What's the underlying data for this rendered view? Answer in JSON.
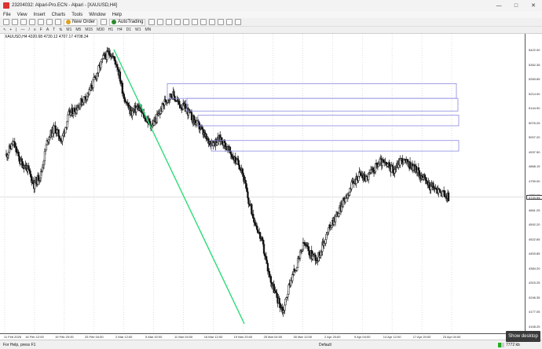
{
  "window": {
    "title": "23204032: Alpari-Pro.ECN - Alpari - [XAUUSD,H4]",
    "minimize": "—",
    "maximize": "□",
    "close": "✕"
  },
  "menu": [
    "File",
    "View",
    "Insert",
    "Charts",
    "Tools",
    "Window",
    "Help"
  ],
  "toolbar": {
    "new_order_label": "New Order",
    "autotrading_label": "AutoTrading",
    "timeframes": [
      "M1",
      "M5",
      "M15",
      "M30",
      "H1",
      "H4",
      "D1",
      "W1",
      "MN"
    ]
  },
  "chart": {
    "info_line": "XAUUSD,H4  4320.68 4730.12 4707.17 4708.34",
    "current_price_label": "4720.94",
    "price_ticks": [
      "5422.00",
      "5352.35",
      "5283.65",
      "5214.00",
      "5144.90",
      "5076.25",
      "5007.20",
      "4937.50",
      "4868.15",
      "4799.00",
      "4729.95",
      "4661.25",
      "4592.20",
      "4522.65",
      "4453.85",
      "4384.20",
      "4315.25",
      "4246.35",
      "4177.05",
      "4108.25"
    ],
    "time_ticks": [
      "11 Feb 2026",
      "16 Feb 12:00",
      "19 Feb 20:00",
      "25 Feb 04:00",
      "2 Mar 12:00",
      "5 Mar 20:00",
      "11 Mar 04:00",
      "16 Mar 12:00",
      "19 Mar 20:00",
      "25 Mar 04:00",
      "30 Mar 12:00",
      "2 Apr 20:00",
      "9 Apr 04:00",
      "14 Apr 12:00",
      "17 Apr 20:00",
      "23 Apr 04:00"
    ]
  },
  "chart_data": {
    "type": "candlestick",
    "symbol": "XAUUSD",
    "timeframe": "H4",
    "ylim": [
      4108.25,
      5422.0
    ],
    "grid": true,
    "close_path": [
      4920,
      4980,
      4890,
      4860,
      4780,
      4830,
      5000,
      5050,
      4990,
      5110,
      5140,
      5180,
      5220,
      5300,
      5380,
      5410,
      5350,
      5200,
      5120,
      5150,
      5100,
      5060,
      5110,
      5180,
      5210,
      5160,
      5140,
      5090,
      5050,
      4990,
      4980,
      5000,
      4950,
      4900,
      4860,
      4700,
      4600,
      4500,
      4350,
      4250,
      4180,
      4320,
      4400,
      4500,
      4450,
      4430,
      4520,
      4600,
      4650,
      4720,
      4780,
      4830,
      4810,
      4850,
      4890,
      4870,
      4850,
      4900,
      4880,
      4860,
      4820,
      4780,
      4760,
      4740,
      4720
    ],
    "trendline": {
      "from": 5422,
      "to": 4120
    },
    "zones": [
      {
        "top": 5260,
        "bottom": 5190
      },
      {
        "top": 5190,
        "bottom": 5130
      },
      {
        "top": 5110,
        "bottom": 5060
      },
      {
        "top": 4990,
        "bottom": 4940
      }
    ],
    "colors": {
      "candles": "#111111",
      "trendline": "#2edc78",
      "zone_border": "#8a8ae0",
      "grid": "#c8c8c8"
    }
  },
  "status": {
    "help": "For Help, press F1",
    "profile": "Default",
    "connection": "7772 kb",
    "tooltip": "Show desktop"
  }
}
